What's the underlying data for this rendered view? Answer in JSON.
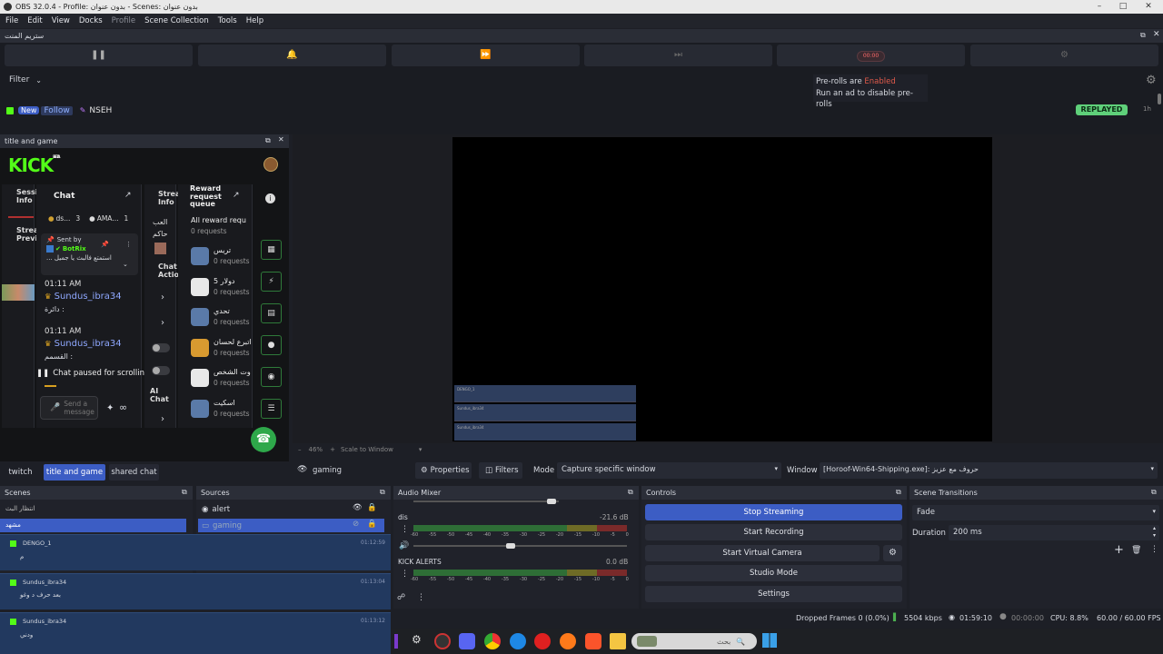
{
  "window": {
    "title": "OBS 32.0.4 - Profile: بدون عنوان - Scenes: بدون عنوان"
  },
  "menu": [
    "File",
    "Edit",
    "View",
    "Docks",
    "Profile",
    "Scene Collection",
    "Tools",
    "Help"
  ],
  "stream_dock": {
    "title": "ستريم المنت",
    "timer": "00:00",
    "filter_label": "Filter",
    "event": {
      "new": "New",
      "follow": "Follow",
      "user": "NSEH",
      "badge": "REPLAYED",
      "time": "1h"
    },
    "preroll": {
      "line1_prefix": "Pre-rolls are ",
      "line1_status": "Enabled",
      "line2": "Run an ad to disable pre-rolls"
    }
  },
  "title_game_dock": {
    "title": "title and game",
    "logo": "KICK",
    "beta": "BETA",
    "session_info": "Session Info",
    "stream_preview": "Stream Preview",
    "chat": {
      "title": "Chat",
      "tab1_label": "ds...",
      "tab1_count": "3",
      "tab2_label": "AMA...",
      "tab2_count": "1",
      "sent_by": "Sent by",
      "sender": "BotRix",
      "pinned_text": "... استمتع فالبث يا جميل",
      "messages": [
        {
          "time": "01:11 AM",
          "user": "Sundus_ibra34",
          "text": "دائرة :"
        },
        {
          "time": "01:11 AM",
          "user": "Sundus_ibra34",
          "text": "القسمم :"
        }
      ],
      "paused": "Chat paused for scrolling",
      "input_placeholder": "Send a message"
    },
    "stream_info": "Stream Info",
    "stream_info_lines": [
      "العب",
      "حاكم"
    ],
    "chat_actions": "Chat Actions",
    "ai_chat_mode": "AI Chat Mode",
    "reward_queue": {
      "title": "Reward request queue",
      "all_label": "All reward requ",
      "all_count": "0 requests",
      "items": [
        {
          "name": "تريس",
          "count": "0 requests"
        },
        {
          "name": "دولار 5",
          "count": "0 requests"
        },
        {
          "name": "تحدي",
          "count": "0 requests"
        },
        {
          "name": "اتبرع لحسان",
          "count": "0 requests"
        },
        {
          "name": "اوت الشخص",
          "count": "0 requests"
        },
        {
          "name": "اسكيت",
          "count": "0 requests"
        }
      ]
    }
  },
  "preview": {
    "zoom": "46%",
    "scale_mode": "Scale to Window",
    "overlay_rows": [
      "DENGO_1",
      "Sundus_ibra34",
      "Sundus_ibra34"
    ]
  },
  "dock_tabs": [
    "twitch",
    "title and game",
    "shared chat"
  ],
  "source_toolbar": {
    "source": "gaming",
    "properties": "Properties",
    "filters": "Filters",
    "mode_label": "Mode",
    "mode_value": "Capture specific window",
    "window_label": "Window",
    "window_value": "[Horoof-Win64-Shipping.exe]: حروف مع عزيز"
  },
  "scenes": {
    "title": "Scenes",
    "items": [
      "انتظار البث",
      "مشهد"
    ]
  },
  "sources": {
    "title": "Sources",
    "items": [
      "alert",
      "gaming"
    ]
  },
  "audio_mixer": {
    "title": "Audio Mixer",
    "channels": [
      {
        "name": "dis",
        "level": "-21.6 dB",
        "fill": 0.72
      },
      {
        "name": "KICK ALERTS",
        "level": "0.0 dB",
        "fill": 0.0
      }
    ],
    "ticks": [
      "-60",
      "-55",
      "-50",
      "-45",
      "-40",
      "-35",
      "-30",
      "-25",
      "-20",
      "-15",
      "-10",
      "-5",
      "0"
    ]
  },
  "controls": {
    "title": "Controls",
    "buttons": [
      "Stop Streaming",
      "Start Recording",
      "Start Virtual Camera",
      "Studio Mode",
      "Settings"
    ]
  },
  "transitions": {
    "title": "Scene Transitions",
    "type": "Fade",
    "duration_label": "Duration",
    "duration_value": "200 ms"
  },
  "overlay_chat": [
    {
      "user": "DENGO_1",
      "time": "01:12:59",
      "text": "م"
    },
    {
      "user": "Sundus_ibra34",
      "time": "01:13:04",
      "text": "بعد حرف د وغو"
    },
    {
      "user": "Sundus_ibra34",
      "time": "01:13:12",
      "text": "ودني"
    }
  ],
  "status": {
    "dropped": "Dropped Frames 0 (0.0%)",
    "bitrate": "5504 kbps",
    "stream_time": "01:59:10",
    "rec_time": "00:00:00",
    "cpu": "CPU: 8.8%",
    "fps": "60.00 / 60.00 FPS"
  },
  "taskbar": {
    "search_placeholder": "بحث"
  },
  "colors": {
    "accent": "#3c5dc4",
    "kick_green": "#53fc18",
    "replayed": "#5fd07a",
    "enabled": "#e05a4a"
  }
}
